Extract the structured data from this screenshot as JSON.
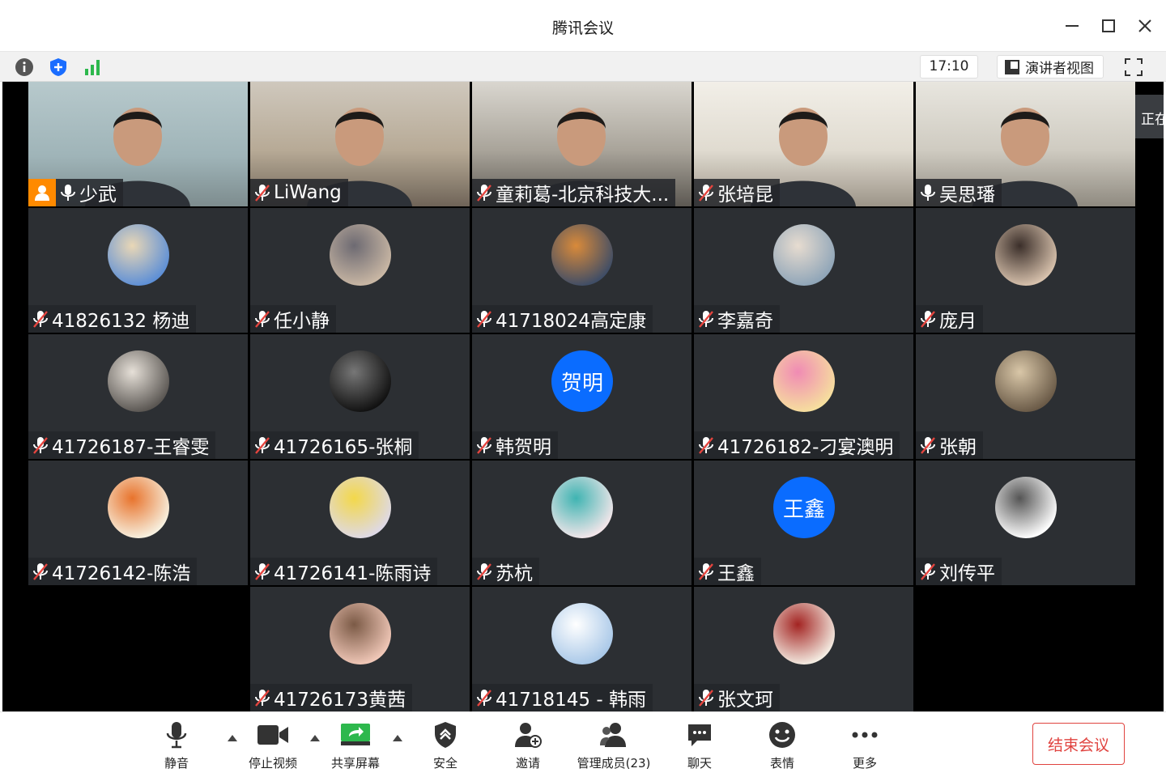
{
  "window": {
    "title": "腾讯会议"
  },
  "infobar": {
    "time": "17:10",
    "speaker_view_label": "演讲者视图"
  },
  "side_tab_label": "正在",
  "participants": [
    {
      "name": "少武",
      "type": "camera",
      "muted": false,
      "host": true
    },
    {
      "name": "LiWang",
      "type": "camera",
      "muted": true
    },
    {
      "name": "童莉葛-北京科技大...",
      "type": "camera",
      "muted": true
    },
    {
      "name": "张培昆",
      "type": "camera",
      "muted": true
    },
    {
      "name": "吴思璠",
      "type": "camera",
      "muted": false
    },
    {
      "name": "41826132 杨迪",
      "type": "avatar",
      "muted": true,
      "avatar_theme": "rose-dome"
    },
    {
      "name": "任小静",
      "type": "avatar",
      "muted": true,
      "avatar_theme": "anime-girl"
    },
    {
      "name": "41718024高定康",
      "type": "avatar",
      "muted": true,
      "avatar_theme": "fire-scene"
    },
    {
      "name": "李嘉奇",
      "type": "avatar",
      "muted": true,
      "avatar_theme": "photo-collage"
    },
    {
      "name": "庞月",
      "type": "avatar",
      "muted": true,
      "avatar_theme": "baby-girl"
    },
    {
      "name": "41726187-王睿雯",
      "type": "avatar",
      "muted": true,
      "avatar_theme": "dark-figure"
    },
    {
      "name": "41726165-张桐",
      "type": "avatar",
      "muted": true,
      "avatar_theme": "monkey-bw"
    },
    {
      "name": "韩贺明",
      "type": "avatar",
      "muted": true,
      "avatar_text": "贺明"
    },
    {
      "name": "41726182-刁宴澳明",
      "type": "avatar",
      "muted": true,
      "avatar_theme": "cartoon-pink"
    },
    {
      "name": "张朝",
      "type": "avatar",
      "muted": true,
      "avatar_theme": "dog-sunglasses"
    },
    {
      "name": "41726142-陈浩",
      "type": "avatar",
      "muted": true,
      "avatar_theme": "magikarp"
    },
    {
      "name": "41726141-陈雨诗",
      "type": "avatar",
      "muted": true,
      "avatar_theme": "yellow-bird"
    },
    {
      "name": "苏杭",
      "type": "avatar",
      "muted": true,
      "avatar_theme": "masked-girl"
    },
    {
      "name": "王鑫",
      "type": "avatar",
      "muted": true,
      "avatar_text": "王鑫"
    },
    {
      "name": "刘传平",
      "type": "avatar",
      "muted": true,
      "avatar_theme": "sketch-boy"
    },
    {
      "name": "41726173黄茜",
      "type": "avatar",
      "muted": true,
      "avatar_theme": "piglet"
    },
    {
      "name": "41718145 - 韩雨",
      "type": "avatar",
      "muted": true,
      "avatar_theme": "sky-sketch"
    },
    {
      "name": "张文珂",
      "type": "avatar",
      "muted": true,
      "avatar_theme": "red-hood"
    }
  ],
  "toolbar": {
    "mute_label": "静音",
    "stop_video_label": "停止视频",
    "share_screen_label": "共享屏幕",
    "security_label": "安全",
    "invite_label": "邀请",
    "manage_members_label": "管理成员(23)",
    "chat_label": "聊天",
    "reactions_label": "表情",
    "more_label": "更多",
    "end_meeting_label": "结束会议"
  },
  "colors": {
    "accent_blue": "#0a6cff",
    "end_red": "#e0433f",
    "host_orange": "#ff8a00",
    "tile_bg": "#2c2f33",
    "signal_green": "#2db84d"
  }
}
